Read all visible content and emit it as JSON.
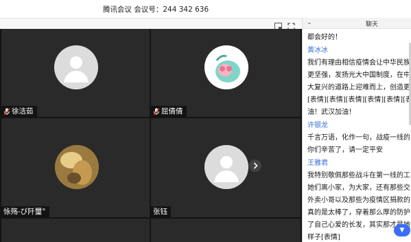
{
  "window": {
    "title": "腾讯会议 会议号：244 342 636"
  },
  "chat": {
    "collapse_icon": "chevron-down-icon",
    "title": "聊天",
    "lines": [
      {
        "text": "都会好的！",
        "kind": "message"
      },
      {
        "text": "黄冰冰",
        "kind": "sender"
      },
      {
        "text": "我们有理由相信疫情会让中华民族",
        "kind": "message"
      },
      {
        "text": "更坚强，发扬光大中国制度，在中",
        "kind": "message"
      },
      {
        "text": "大复兴的道路上迎难而上，创造更",
        "kind": "message"
      },
      {
        "text": "[表情][表情][表情][表情][表情][表",
        "kind": "message"
      },
      {
        "text": "油！武汉加油！",
        "kind": "message"
      },
      {
        "text": "许银龙",
        "kind": "sender"
      },
      {
        "text": "千言万语，化作一句，战疫一线的",
        "kind": "message"
      },
      {
        "text": "你们辛苦了，请一定平安",
        "kind": "message"
      },
      {
        "text": "王雅君",
        "kind": "sender"
      },
      {
        "text": "我特别敬佩那些战斗在第一线的工",
        "kind": "message"
      },
      {
        "text": "她们离小家，为大家，还有那些交",
        "kind": "message"
      },
      {
        "text": "外卖小哥以及那些为疫情区捐款的",
        "kind": "message"
      },
      {
        "text": "真的是太棒了，穿着那么厚的防护",
        "kind": "message"
      },
      {
        "text": "了自己心爱的长发，其实那才是她",
        "kind": "message"
      },
      {
        "text": "样子[表情]",
        "kind": "message"
      }
    ]
  },
  "participants": [
    {
      "name": "徐洁茹",
      "muted": true,
      "avatar": "default-avatar"
    },
    {
      "name": "屈倩倩",
      "muted": true,
      "avatar": "cartoon-avatar"
    },
    {
      "name": "怺殇-び阡璽°",
      "muted": false,
      "avatar": "photo-avatar"
    },
    {
      "name": "张钰",
      "muted": false,
      "avatar": "default-avatar"
    }
  ],
  "colors": {
    "accent": "#3b6ef5",
    "sender_name": "#3a6fd8",
    "video_bg": "#2a2a2a"
  }
}
